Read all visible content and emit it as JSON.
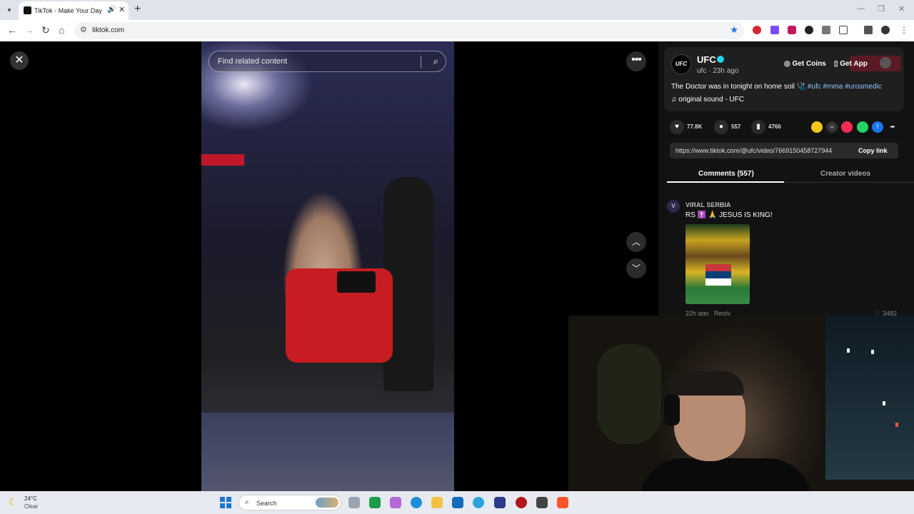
{
  "browser": {
    "tab_title": "TikTok - Make Your Day",
    "url": "tiktok.com"
  },
  "video_page": {
    "search_placeholder": "Find related content",
    "more_label": "•••"
  },
  "author": {
    "avatar_text": "UFC",
    "name": "UFC",
    "meta": "ufc · 23h ago",
    "caption_text": "The Doctor was in tonight on home soil 🩺 ",
    "caption_tags": "#ufc #mma #urosmedic",
    "sound": "original sound - UFC"
  },
  "header_actions": {
    "get_coins": "Get Coins",
    "get_app": "Get App"
  },
  "stats": {
    "likes": "77.8K",
    "comments": "557",
    "saves": "4766"
  },
  "share": {
    "link": "https://www.tiktok.com/@ufc/video/7669150458727944",
    "copy_label": "Copy link"
  },
  "tabs": {
    "comments": "Comments (557)",
    "creator_videos": "Creator videos"
  },
  "comment": {
    "user": "VIRAL SERBIA",
    "text": "RS ✝️ 🙏 JESUS IS KING!",
    "time": "22h ago",
    "reply": "Reply",
    "likes": "♡ 3482"
  },
  "taskbar": {
    "temp": "24°C",
    "condition": "Clear",
    "search_label": "Search"
  },
  "colors": {
    "accent_tag": "#8ec7ff",
    "verified": "#20d5ec",
    "bookmark_star": "#1a73e8"
  },
  "icons": [
    "close-icon",
    "search-icon",
    "more-icon",
    "chevron-up-icon",
    "chevron-down-icon",
    "heart-icon",
    "comment-icon",
    "bookmark-icon",
    "share-icon",
    "music-note-icon",
    "coins-icon",
    "phone-icon",
    "moon-icon",
    "windows-start-icon"
  ]
}
